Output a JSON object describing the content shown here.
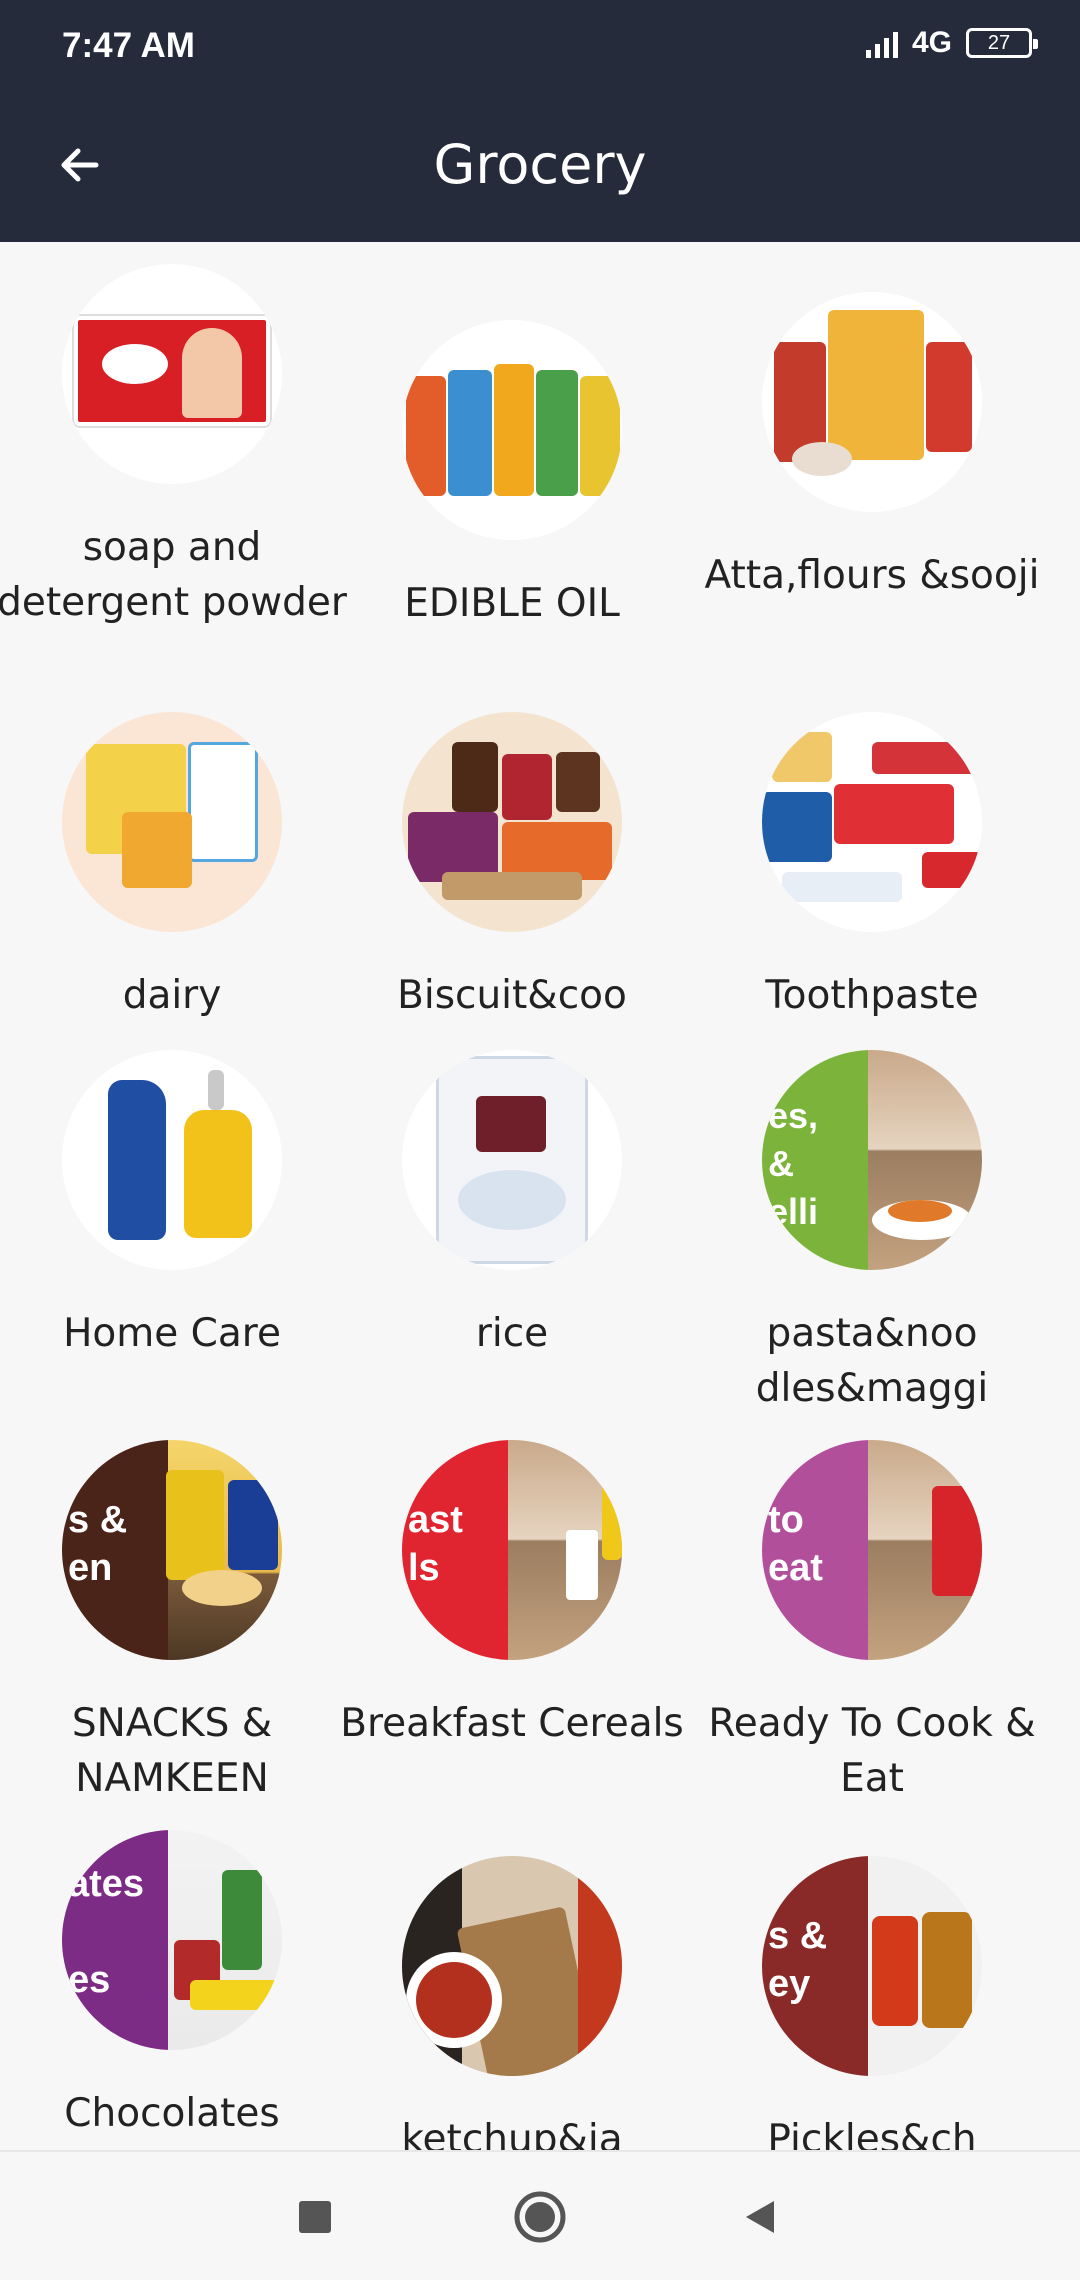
{
  "status_bar": {
    "time": "7:47 AM",
    "network": "4G",
    "battery": "27",
    "icons": [
      "signal-icon",
      "battery-icon"
    ]
  },
  "app_bar": {
    "title": "Grocery",
    "back_icon": "arrow-left-icon"
  },
  "categories": [
    {
      "label": "soap and detergent powder"
    },
    {
      "label": "EDIBLE OIL"
    },
    {
      "label": "Atta,flours &sooji"
    },
    {
      "label": "dairy"
    },
    {
      "label": "Biscuit&coo"
    },
    {
      "label": "Toothpaste"
    },
    {
      "label": "Home Care"
    },
    {
      "label": "rice"
    },
    {
      "label": "pasta&noo dles&maggi"
    },
    {
      "label": "SNACKS & NAMKEEN"
    },
    {
      "label": "Breakfast Cereals"
    },
    {
      "label": "Ready To Cook & Eat"
    },
    {
      "label": "Chocolates"
    },
    {
      "label": "ketchup&ja"
    },
    {
      "label": "Pickles&ch"
    }
  ],
  "thumb_texts": {
    "pasta": "es,\n&\nelli",
    "snacks": "s &\nen",
    "breakfast": "ast\nls",
    "ready": "to\neat",
    "chocolates": "ates\n\nes",
    "pickles": "s &\ney"
  },
  "nav_bar": {
    "icons": [
      "recents-square-icon",
      "home-circle-icon",
      "back-triangle-icon"
    ]
  }
}
